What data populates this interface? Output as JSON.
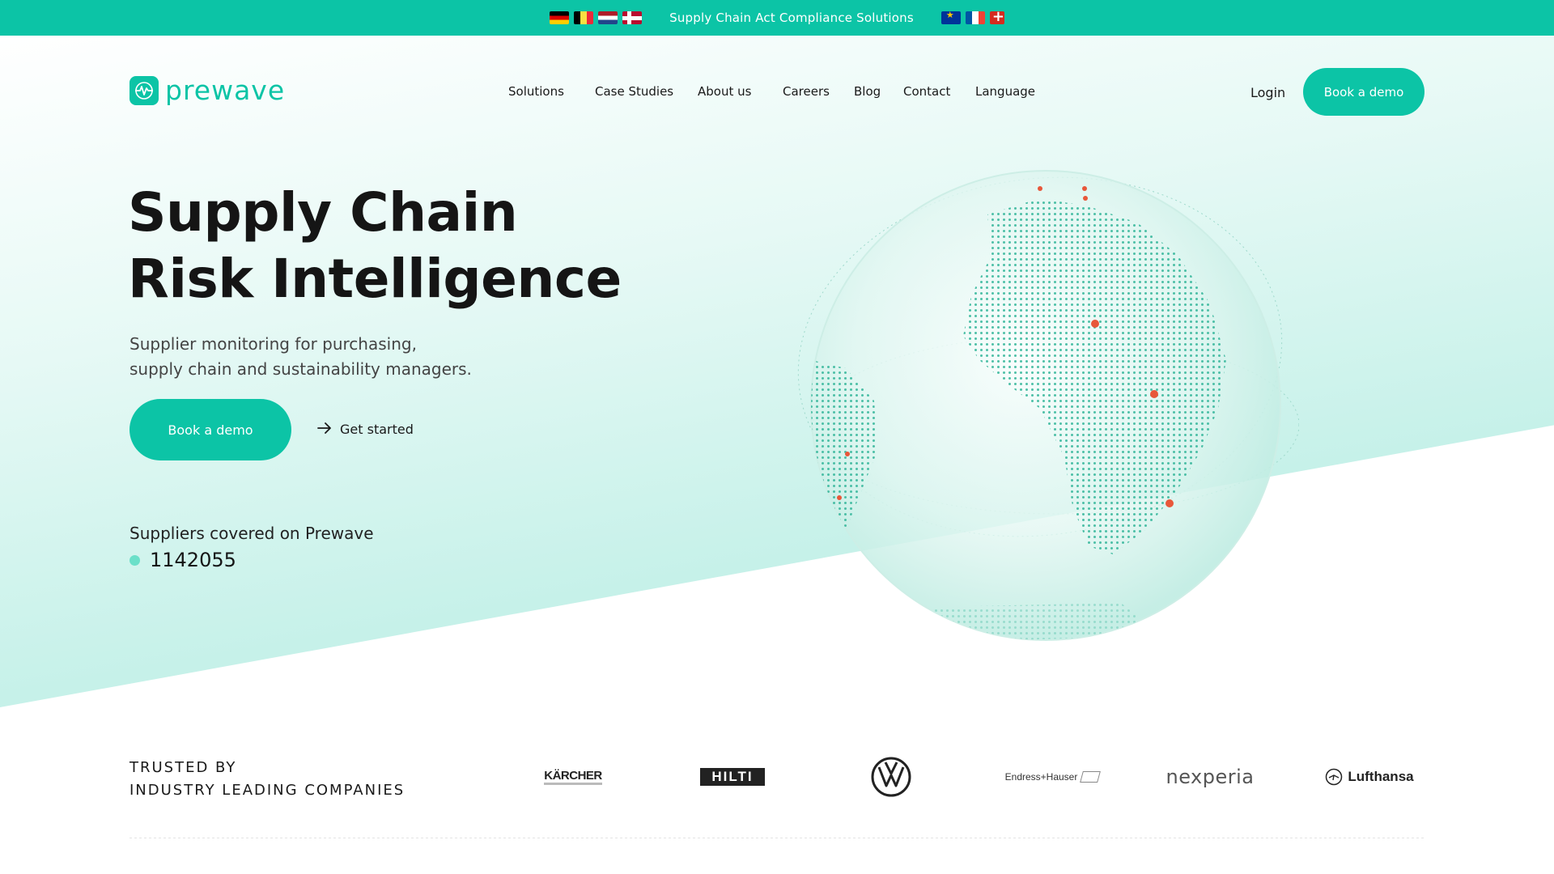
{
  "topbar": {
    "left_flags": [
      "germany-flag",
      "belgium-flag",
      "netherlands-flag",
      "norway-flag"
    ],
    "text": "Supply Chain Act Compliance Solutions",
    "right_flags": [
      "eu-flag",
      "france-flag",
      "switzerland-flag"
    ]
  },
  "header": {
    "logo_text": "prewave",
    "nav": [
      "Solutions",
      "Case Studies",
      "About us",
      "Careers",
      "Blog",
      "Contact",
      "Language"
    ],
    "login": "Login",
    "cta": "Book a demo"
  },
  "hero": {
    "title_line1": "Supply Chain",
    "title_line2": "Risk Intelligence",
    "subtitle": "Supplier monitoring for purchasing,\nsupply chain and sustainability managers.",
    "cta_primary": "Book a demo",
    "cta_secondary": "Get started",
    "suppliers_label": "Suppliers covered on Prewave",
    "suppliers_count": "1142055"
  },
  "trusted": {
    "heading": "TRUSTED BY\nINDUSTRY LEADING COMPANIES",
    "logos": [
      "KÄRCHER",
      "HILTI",
      "VW",
      "Endress+Hauser",
      "nexperia",
      "Lufthansa"
    ]
  },
  "colors": {
    "accent": "#0cc4a6",
    "hotspot": "#e8573a"
  }
}
